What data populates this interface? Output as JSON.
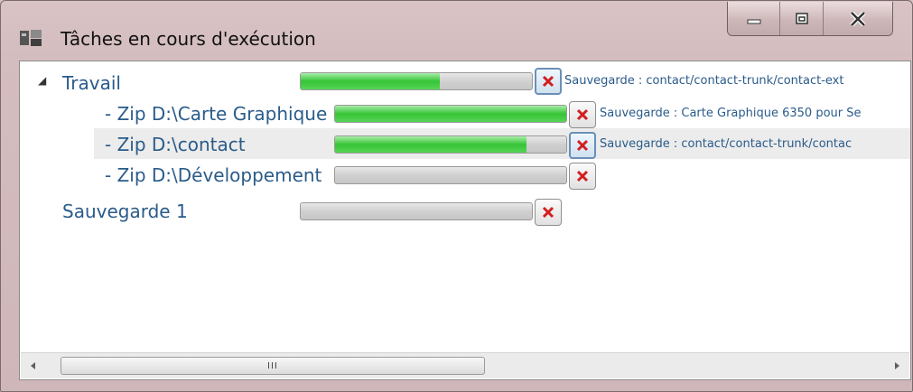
{
  "window": {
    "title": "Tâches en cours d'exécution",
    "app_icon": "tasks-app-icon",
    "buttons": {
      "minimize_icon": "minimize-icon",
      "maximize_icon": "maximize-icon",
      "close_icon": "close-icon"
    }
  },
  "tree": {
    "root": {
      "label": "Travail",
      "expanded": true,
      "progress": 0.6,
      "status": "Sauvegarde : contact/contact-trunk/contact-ext"
    },
    "children": [
      {
        "label": "- Zip D:\\Carte Graphique",
        "progress": 1.0,
        "status": "Sauvegarde : Carte Graphique 6350 pour Se",
        "selected": false
      },
      {
        "label": "- Zip D:\\contact",
        "progress": 0.83,
        "status": "Sauvegarde : contact/contact-trunk/contac",
        "selected": true
      },
      {
        "label": "- Zip D:\\Développement",
        "progress": 0.0,
        "status": "",
        "selected": false
      }
    ],
    "sibling": {
      "label": "Sauvegarde 1",
      "progress": 0.0,
      "status": ""
    }
  },
  "scrollbar": {
    "grip": "III"
  },
  "colors": {
    "accent": "#2a5b8a",
    "progress_fill": "#37c437",
    "cancel_x": "#d21f1f",
    "selected_row": "#ececec"
  }
}
